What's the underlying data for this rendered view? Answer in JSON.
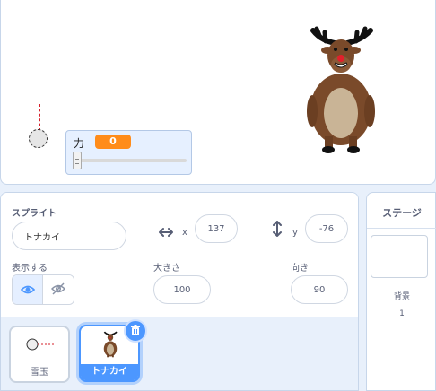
{
  "stage": {
    "monitor": {
      "label": "力",
      "value": "0",
      "slider_fraction": 0
    }
  },
  "sprite_info": {
    "title": "スプライト",
    "name": "トナカイ",
    "x_label": "x",
    "x_value": "137",
    "y_label": "y",
    "y_value": "-76",
    "show_label": "表示する",
    "size_label": "大きさ",
    "size_value": "100",
    "direction_label": "向き",
    "direction_value": "90"
  },
  "sprites": [
    {
      "name": "雪玉",
      "selected": false
    },
    {
      "name": "トナカイ",
      "selected": true
    }
  ],
  "stage_pane": {
    "title": "ステージ",
    "backdrops_label": "背景",
    "backdrops_count": "1"
  },
  "colors": {
    "accent": "#4c97ff",
    "monitor_value_bg": "#ff8c1a",
    "line_red": "#d6202b"
  },
  "icons": [
    "horizontal-arrows-icon",
    "vertical-arrows-icon",
    "eye-icon",
    "eye-off-icon",
    "trash-icon"
  ]
}
